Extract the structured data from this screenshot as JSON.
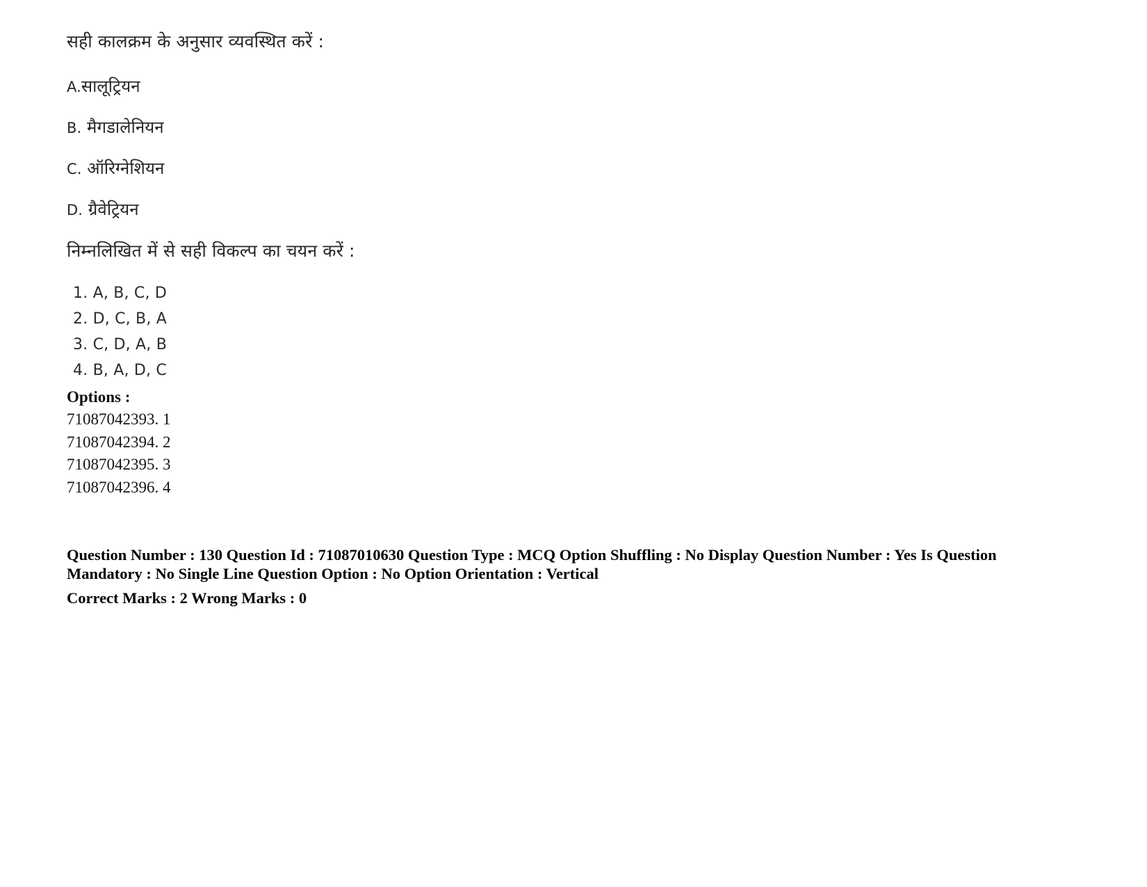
{
  "document": {
    "page_background": "#ffffff",
    "text_color": "#1a1a1a"
  },
  "question": {
    "stem": "सही कालक्रम के अनुसार व्यवस्थित करें :",
    "items": [
      {
        "key": "A.",
        "text": "सालूट्रियन"
      },
      {
        "key": "B.",
        "text": " मैगडालेनियन"
      },
      {
        "key": "C.",
        "text": " ऑरिग्नेशियन"
      },
      {
        "key": "D.",
        "text": " ग्रैवेट्रियन"
      }
    ],
    "prompt": "निम्नलिखित में से सही विकल्प का चयन करें :",
    "choices": [
      "1. A, B, C, D",
      "2. D, C, B, A",
      "3. C, D, A, B",
      "4. B, A, D, C"
    ]
  },
  "options_section": {
    "heading": "Options :",
    "rows": [
      "71087042393. 1",
      "71087042394. 2",
      "71087042395. 3",
      "71087042396. 4"
    ]
  },
  "metadata": {
    "line1": "Question Number : 130 Question Id : 71087010630 Question Type : MCQ Option Shuffling : No Display Question Number : Yes Is Question Mandatory : No Single Line Question Option : No Option Orientation : Vertical",
    "line2": "Correct Marks : 2 Wrong Marks : 0",
    "fields": {
      "question_number": "130",
      "question_id": "71087010630",
      "question_type": "MCQ",
      "option_shuffling": "No",
      "display_question_number": "Yes",
      "is_question_mandatory": "No",
      "single_line_question_option": "No",
      "option_orientation": "Vertical",
      "correct_marks": "2",
      "wrong_marks": "0"
    }
  }
}
